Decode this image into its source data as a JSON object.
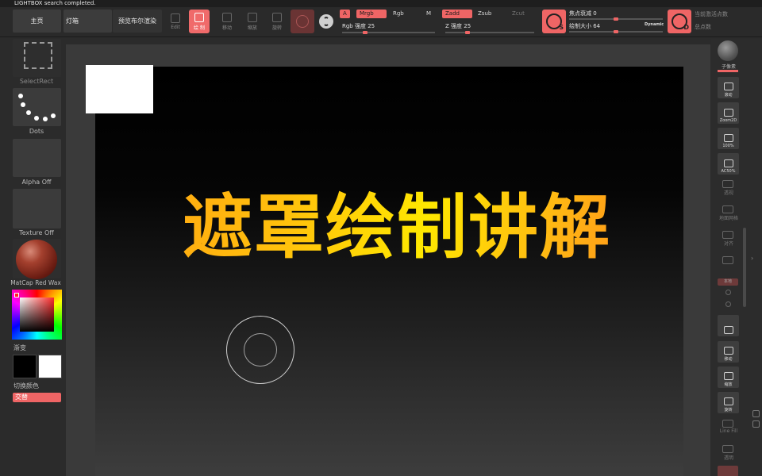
{
  "status_message": "LIGHTBOX search completed.",
  "menu": {
    "home": "主页",
    "lightbox": "灯箱",
    "preview": "预览布尔渲染"
  },
  "toolbar": {
    "edit": "Edit",
    "draw": "绘 制",
    "move": "移动",
    "scale": "缩放",
    "rotate": "旋转",
    "a_label": "A",
    "mrgb": "Mrgb",
    "rgb": "Rgb",
    "m": "M",
    "zadd": "Zadd",
    "zsub": "Zsub",
    "zcut": "Zcut",
    "rgb_intensity": "Rgb 强度 25",
    "z_intensity": "Z 强度 25",
    "focal_shift": "焦点衰减 0",
    "draw_size": "绘制大小 64",
    "dynamic": "Dynamic",
    "active_points": "当前激活点数",
    "total_points": "总点数",
    "rgb_intensity_value": 25,
    "z_intensity_value": 25,
    "focal_shift_value": 0,
    "draw_size_value": 64
  },
  "left_panel": {
    "brush": "SelectRect",
    "stroke": "Dots",
    "alpha": "Alpha Off",
    "texture": "Texture Off",
    "material": "MatCap Red Wax",
    "gradient": "渐变",
    "switch_color": "切换颜色",
    "alternate": "交替"
  },
  "right_panel": {
    "buttons": [
      "子像素",
      "滚动",
      "Zoom2D",
      "100%",
      "AC50%",
      "透视",
      "地面网格",
      "对齐",
      "本地",
      "移动",
      "缩放",
      "旋转",
      "Line Fill",
      "透明"
    ]
  },
  "canvas": {
    "headline": "遮罩绘制讲解"
  },
  "colors": {
    "accent": "#ef6565",
    "headline_start": "#ffa313",
    "headline_mid": "#ffe800",
    "headline_end": "#ff8a1b"
  }
}
